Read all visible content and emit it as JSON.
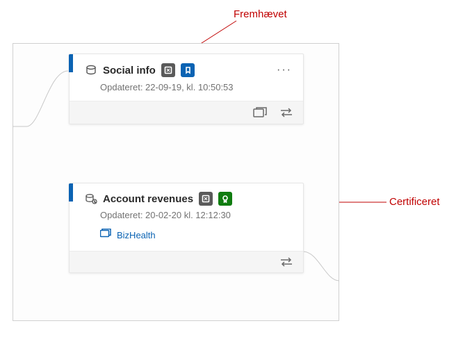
{
  "annotations": {
    "promoted": "Fremhævet",
    "certified": "Certificeret"
  },
  "cards": [
    {
      "title": "Social info",
      "updated": "Opdateret: 22-09-19, kl. 10:50:53",
      "type_icon": "dataset-icon",
      "badges": [
        "sensitivity",
        "promoted"
      ],
      "link": null,
      "footer_icons": [
        "open-icon",
        "swap-icon"
      ]
    },
    {
      "title": "Account revenues",
      "updated": "Opdateret: 20-02-20 kl. 12:12:30",
      "type_icon": "dataflow-icon",
      "badges": [
        "sensitivity",
        "certified"
      ],
      "link": "BizHealth",
      "footer_icons": [
        "swap-icon"
      ]
    }
  ],
  "colors": {
    "accent": "#0b63b3",
    "certified": "#107c10",
    "annotation": "#c00000"
  }
}
